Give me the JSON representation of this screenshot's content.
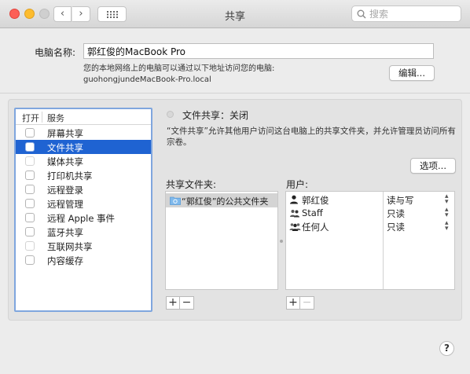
{
  "window": {
    "title": "共享",
    "search_placeholder": "搜索"
  },
  "computer_name": {
    "label": "电脑名称:",
    "value": "郭红俊的MacBook Pro",
    "description_line1": "您的本地网络上的电脑可以通过以下地址访问您的电脑:",
    "description_line2": "guohongjundeMacBook-Pro.local",
    "edit_button": "编辑..."
  },
  "services": {
    "col_open": "打开",
    "col_service": "服务",
    "items": [
      {
        "label": "屏幕共享",
        "checked": false,
        "selected": false
      },
      {
        "label": "文件共享",
        "checked": false,
        "selected": true
      },
      {
        "label": "媒体共享",
        "checked": false,
        "selected": false
      },
      {
        "label": "打印机共享",
        "checked": false,
        "selected": false
      },
      {
        "label": "远程登录",
        "checked": false,
        "selected": false
      },
      {
        "label": "远程管理",
        "checked": false,
        "selected": false
      },
      {
        "label": "远程 Apple 事件",
        "checked": false,
        "selected": false
      },
      {
        "label": "蓝牙共享",
        "checked": false,
        "selected": false
      },
      {
        "label": "互联网共享",
        "checked": false,
        "selected": false
      },
      {
        "label": "内容缓存",
        "checked": false,
        "selected": false
      }
    ]
  },
  "detail": {
    "status": "文件共享：关闭",
    "description": "“文件共享”允许其他用户访问这台电脑上的共享文件夹，并允许管理员访问所有宗卷。",
    "options_button": "选项...",
    "shared_folders_label": "共享文件夹:",
    "users_label": "用户:",
    "folders": [
      "“郭红俊”的公共文件夹"
    ],
    "users": [
      {
        "name": "郭红俊",
        "permission": "读与写",
        "icon": "single-user-icon"
      },
      {
        "name": "Staff",
        "permission": "只读",
        "icon": "group-icon"
      },
      {
        "name": "任何人",
        "permission": "只读",
        "icon": "everyone-icon"
      }
    ],
    "add": "+",
    "remove": "−"
  },
  "help": "?"
}
